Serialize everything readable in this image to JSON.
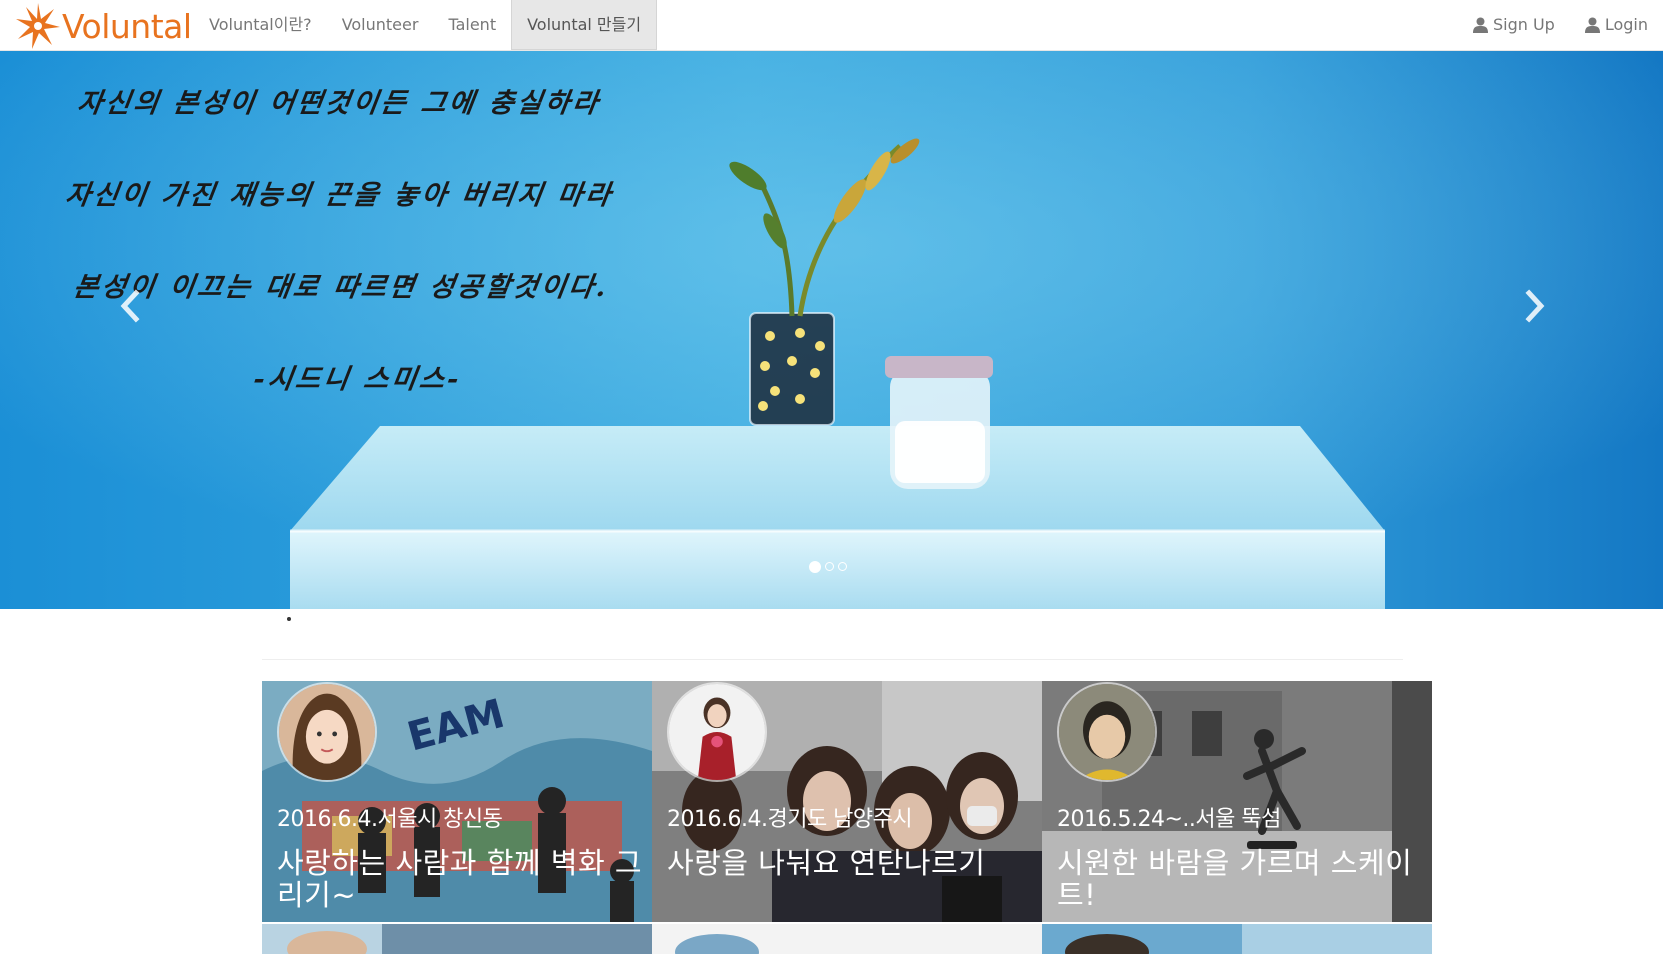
{
  "brand": {
    "name": "Voluntal"
  },
  "nav": {
    "items": [
      {
        "label": "Voluntal이란?"
      },
      {
        "label": "Volunteer"
      },
      {
        "label": "Talent"
      },
      {
        "label": "Voluntal 만들기",
        "active": true
      }
    ],
    "right": [
      {
        "label": "Sign Up",
        "icon": "user-icon"
      },
      {
        "label": "Login",
        "icon": "user-icon"
      }
    ]
  },
  "carousel": {
    "quote_lines": [
      "자신의 본성이 어떤것이든 그에 충실하라",
      "자신이 가진 재능의 끈을 놓아 버리지 마라",
      "본성이 이끄는 대로 따르면 성공할것이다.",
      "-시드니 스미스-"
    ],
    "slide_count": 3,
    "active_slide": 1,
    "prev_icon": "chevron-left-icon",
    "next_icon": "chevron-right-icon"
  },
  "cards": [
    {
      "date": "2016.6.4.서울시 창신동",
      "title": "사랑하는 사람과 함께 벽화 그리기~"
    },
    {
      "date": "2016.6.4.경기도 남양주시",
      "title": "사랑을 나눠요 연탄나르기"
    },
    {
      "date": "2016.5.24~..서울 뚝섬",
      "title": "시원한 바람을 가르며 스케이트!"
    }
  ],
  "colors": {
    "brand": "#e8731f",
    "nav_text": "#777777",
    "sky": "#2e9fdc"
  }
}
